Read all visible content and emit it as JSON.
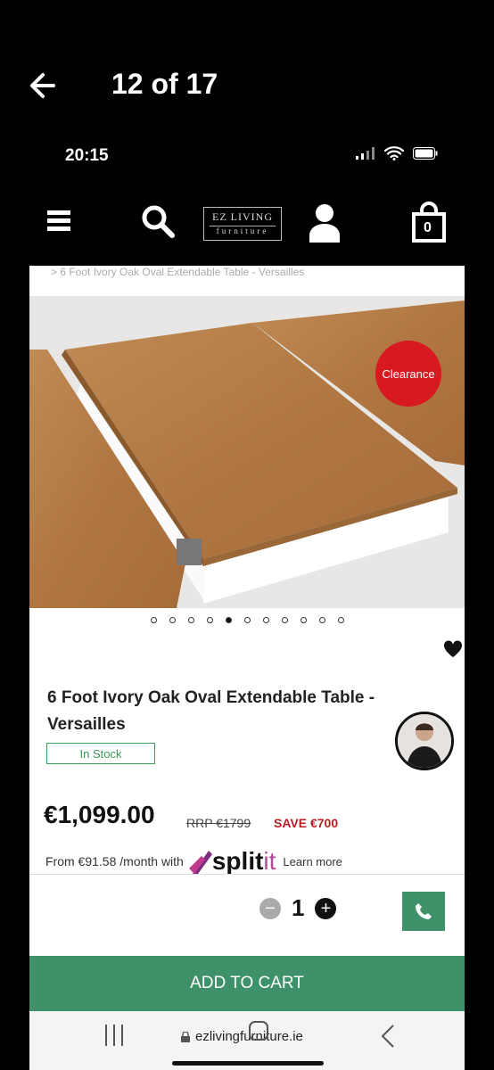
{
  "viewer": {
    "counter": "12 of 17"
  },
  "status_bar": {
    "time": "20:15"
  },
  "header": {
    "logo_line1": "EZ LIVING",
    "logo_line2": "furniture",
    "cart_count": "0"
  },
  "breadcrumb": "> 6 Foot Ivory Oak Oval Extendable Table - Versailles",
  "badge": {
    "clearance": "Clearance"
  },
  "gallery": {
    "dot_count": 11,
    "active_index": 4
  },
  "product": {
    "title": "6 Foot Ivory Oak Oval Extendable Table - Versailles",
    "stock": "In Stock",
    "price": "€1,099.00",
    "rrp": "RRP €1799",
    "save": "SAVE €700",
    "finance_text": "From €91.58 /month with",
    "finance_brand_a": "split",
    "finance_brand_b": "it",
    "learn_more": "Learn more",
    "quantity": "1"
  },
  "actions": {
    "add_to_cart": "ADD TO CART"
  },
  "browser": {
    "url": "ezlivingfurniture.ie"
  },
  "colors": {
    "accent_green": "#3e9168",
    "clearance_red": "#d91920",
    "save_red": "#b81d24"
  },
  "icons": [
    "back-arrow-icon",
    "signal-icon",
    "wifi-icon",
    "battery-icon",
    "menu-icon",
    "search-icon",
    "user-icon",
    "cart-icon",
    "heart-icon",
    "phone-icon",
    "lock-icon"
  ]
}
